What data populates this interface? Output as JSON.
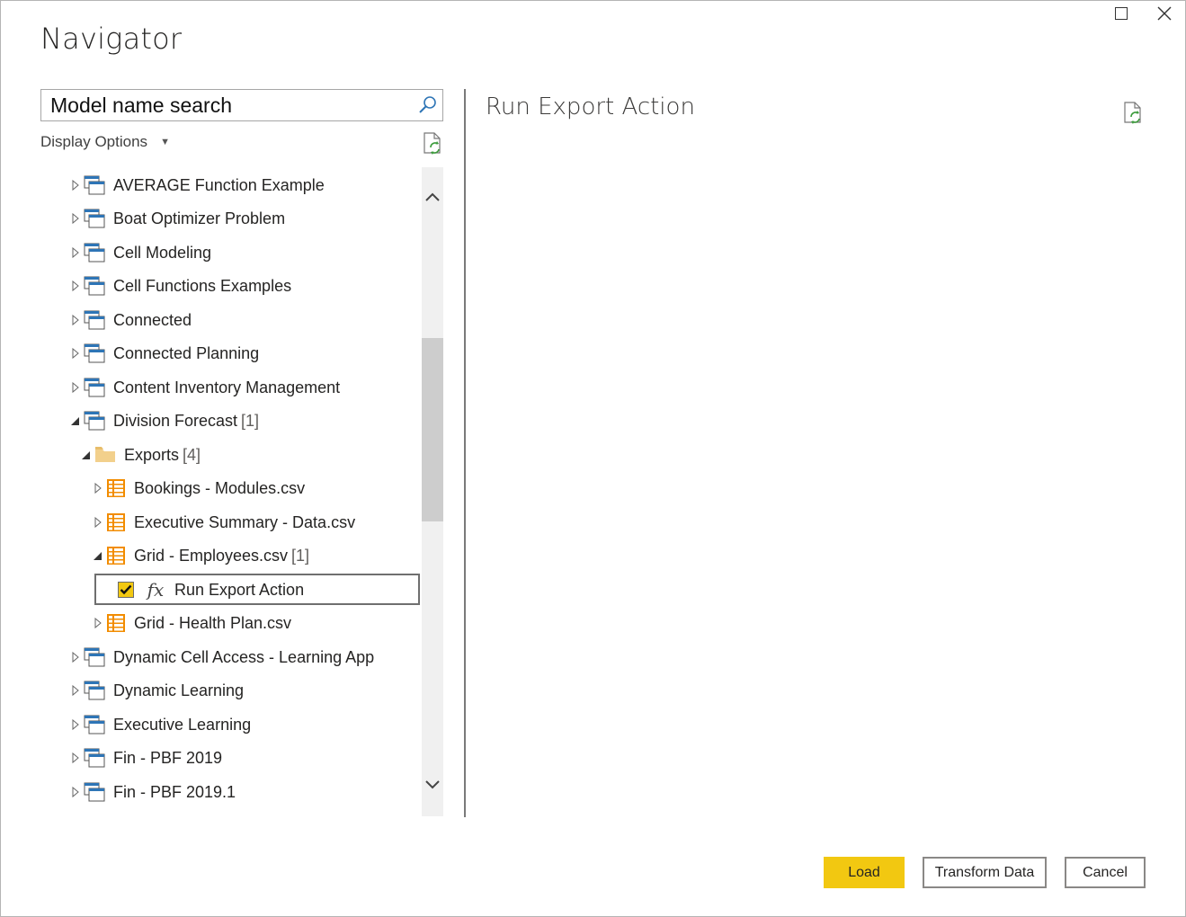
{
  "window": {
    "title": "Navigator"
  },
  "search": {
    "value": "Model name search",
    "placeholder": "Model name search"
  },
  "display_options": {
    "label": "Display Options"
  },
  "tree": {
    "items": [
      {
        "label": "AVERAGE Function Example",
        "count": "",
        "type": "model",
        "expanded": false
      },
      {
        "label": "Boat Optimizer Problem",
        "count": "",
        "type": "model",
        "expanded": false
      },
      {
        "label": "Cell Modeling",
        "count": "",
        "type": "model",
        "expanded": false
      },
      {
        "label": "Cell Functions Examples",
        "count": "",
        "type": "model",
        "expanded": false
      },
      {
        "label": "Connected",
        "count": "",
        "type": "model",
        "expanded": false
      },
      {
        "label": "Connected Planning",
        "count": "",
        "type": "model",
        "expanded": false
      },
      {
        "label": "Content Inventory Management",
        "count": "",
        "type": "model",
        "expanded": false
      },
      {
        "label": "Division Forecast",
        "count": "[1]",
        "type": "model",
        "expanded": true
      },
      {
        "label": "Exports",
        "count": "[4]",
        "type": "folder",
        "expanded": true
      },
      {
        "label": "Bookings - Modules.csv",
        "count": "",
        "type": "file",
        "expanded": false
      },
      {
        "label": "Executive Summary - Data.csv",
        "count": "",
        "type": "file",
        "expanded": false
      },
      {
        "label": "Grid - Employees.csv",
        "count": "[1]",
        "type": "file",
        "expanded": true
      },
      {
        "label": "Run Export Action",
        "count": "",
        "type": "action",
        "checked": true
      },
      {
        "label": "Grid - Health Plan.csv",
        "count": "",
        "type": "file",
        "expanded": false
      },
      {
        "label": "Dynamic Cell Access - Learning App",
        "count": "",
        "type": "model",
        "expanded": false
      },
      {
        "label": "Dynamic Learning",
        "count": "",
        "type": "model",
        "expanded": false
      },
      {
        "label": "Executive Learning",
        "count": "",
        "type": "model",
        "expanded": false
      },
      {
        "label": "Fin - PBF 2019",
        "count": "",
        "type": "model",
        "expanded": false
      },
      {
        "label": "Fin - PBF 2019.1",
        "count": "",
        "type": "model",
        "expanded": false
      }
    ]
  },
  "preview": {
    "title": "Run Export Action"
  },
  "buttons": {
    "load": "Load",
    "transform": "Transform Data",
    "cancel": "Cancel"
  },
  "icons": {
    "fx_glyph": "fx",
    "model_icon": "table-window-icon",
    "folder_icon": "folder-icon",
    "file_icon": "csv-table-icon",
    "action_icon": "function-icon"
  },
  "colors": {
    "accent": "#f2c811",
    "file_orange": "#f28c00",
    "model_blue": "#2e75b6",
    "folder": "#f2d08c"
  }
}
